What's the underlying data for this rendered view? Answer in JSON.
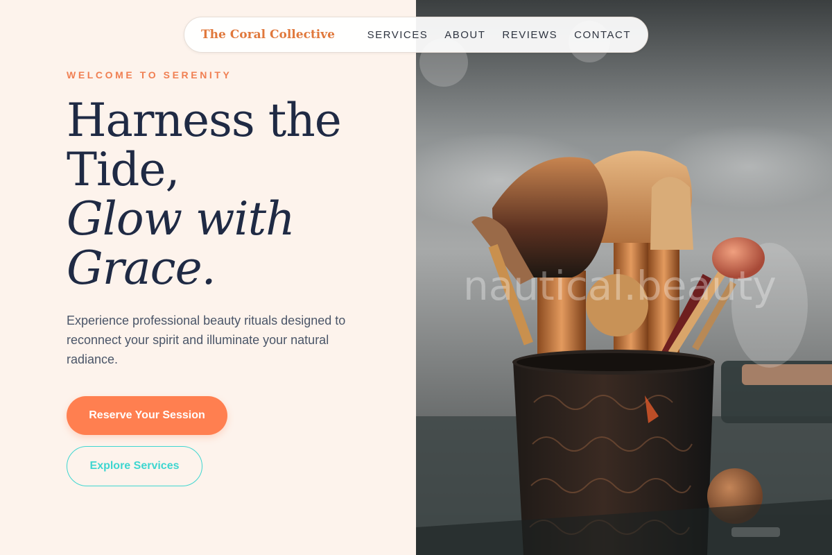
{
  "nav": {
    "brand": "The Coral Collective",
    "links": [
      "SERVICES",
      "ABOUT",
      "REVIEWS",
      "CONTACT"
    ]
  },
  "hero": {
    "eyebrow": "WELCOME TO SERENITY",
    "headline_line1": "Harness the Tide,",
    "headline_line2": "Glow with Grace.",
    "description": "Experience professional beauty rituals designed to reconnect your spirit and illuminate your natural radiance.",
    "primary_cta": "Reserve Your Session",
    "secondary_cta": "Explore Services"
  },
  "image": {
    "watermark": "nautical.beauty",
    "subject": "makeup-brushes-photo"
  },
  "colors": {
    "brand": "#e0783c",
    "accent_coral": "#ff7f50",
    "accent_teal": "#3ed6d0",
    "heading": "#1f2a44",
    "background": "#fdf3ec"
  }
}
